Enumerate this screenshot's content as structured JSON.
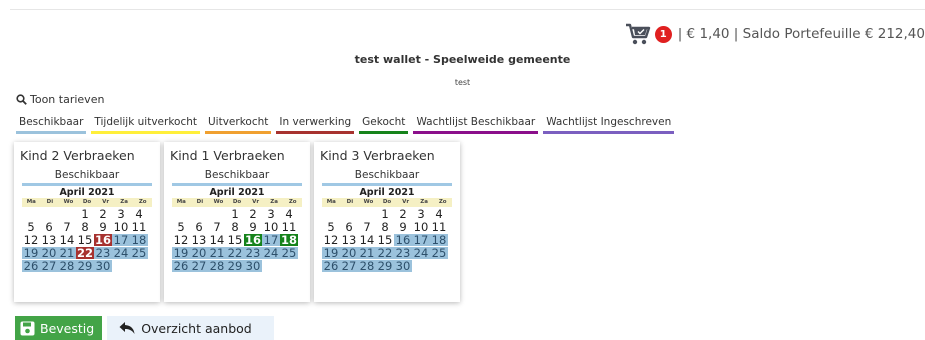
{
  "header": {
    "cart_count": "1",
    "cart_info": "| € 1,40 | Saldo Portefeuille € 212,40"
  },
  "title": "test wallet - Speelweide gemeente",
  "subtitle": "test",
  "rates_link": "Toon tarieven",
  "legend": [
    {
      "label": "Beschikbaar",
      "color": "#9bc2dc"
    },
    {
      "label": "Tijdelijk uitverkocht",
      "color": "#ffef3a"
    },
    {
      "label": "Uitverkocht",
      "color": "#f0a030"
    },
    {
      "label": "In verwerking",
      "color": "#a7322f"
    },
    {
      "label": "Gekocht",
      "color": "#16831b"
    },
    {
      "label": "Wachtlijst Beschikbaar",
      "color": "#8b0f8b"
    },
    {
      "label": "Wachtlijst Ingeschreven",
      "color": "#7b5fc0"
    }
  ],
  "weekdays": [
    "Ma",
    "Di",
    "Wo",
    "Do",
    "Vr",
    "Za",
    "Zo"
  ],
  "cards": [
    {
      "title": "Kind 2 Verbraeken",
      "status": "Beschikbaar",
      "month": "April 2021",
      "weeks": [
        [
          "",
          "",
          "",
          "1",
          "2",
          "3",
          "4"
        ],
        [
          "5",
          "6",
          "7",
          "8",
          "9",
          "10",
          "11"
        ],
        [
          "12",
          "13",
          "14",
          "15",
          "16",
          "17",
          "18"
        ],
        [
          "19",
          "20",
          "21",
          "22",
          "23",
          "24",
          "25"
        ],
        [
          "26",
          "27",
          "28",
          "29",
          "30",
          "",
          ""
        ]
      ],
      "available": [
        "17",
        "18",
        "19",
        "20",
        "21",
        "23",
        "24",
        "25",
        "26",
        "27",
        "28",
        "29",
        "30"
      ],
      "sold": [
        "16",
        "22"
      ],
      "bought": []
    },
    {
      "title": "Kind 1 Verbraeken",
      "status": "Beschikbaar",
      "month": "April 2021",
      "weeks": [
        [
          "",
          "",
          "",
          "1",
          "2",
          "3",
          "4"
        ],
        [
          "5",
          "6",
          "7",
          "8",
          "9",
          "10",
          "11"
        ],
        [
          "12",
          "13",
          "14",
          "15",
          "16",
          "17",
          "18"
        ],
        [
          "19",
          "20",
          "21",
          "22",
          "23",
          "24",
          "25"
        ],
        [
          "26",
          "27",
          "28",
          "29",
          "30",
          "",
          ""
        ]
      ],
      "available": [
        "17",
        "19",
        "20",
        "21",
        "22",
        "23",
        "24",
        "25",
        "26",
        "27",
        "28",
        "29",
        "30"
      ],
      "sold": [],
      "bought": [
        "16",
        "18"
      ]
    },
    {
      "title": "Kind 3 Verbraeken",
      "status": "Beschikbaar",
      "month": "April 2021",
      "weeks": [
        [
          "",
          "",
          "",
          "1",
          "2",
          "3",
          "4"
        ],
        [
          "5",
          "6",
          "7",
          "8",
          "9",
          "10",
          "11"
        ],
        [
          "12",
          "13",
          "14",
          "15",
          "16",
          "17",
          "18"
        ],
        [
          "19",
          "20",
          "21",
          "22",
          "23",
          "24",
          "25"
        ],
        [
          "26",
          "27",
          "28",
          "29",
          "30",
          "",
          ""
        ]
      ],
      "available": [
        "16",
        "17",
        "18",
        "19",
        "20",
        "21",
        "22",
        "23",
        "24",
        "25",
        "26",
        "27",
        "28",
        "29",
        "30"
      ],
      "sold": [],
      "bought": []
    }
  ],
  "buttons": {
    "confirm": "Bevestig",
    "overview": "Overzicht aanbod"
  }
}
